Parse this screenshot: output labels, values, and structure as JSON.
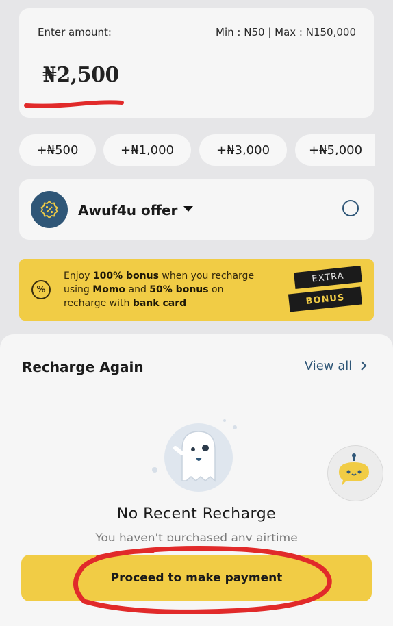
{
  "amount_card": {
    "label": "Enter amount:",
    "limits": "Min : N50 | Max : N150,000",
    "amount": "₦2,500"
  },
  "quick_amounts": [
    "+₦500",
    "+₦1,000",
    "+₦3,000",
    "+₦5,000"
  ],
  "offer": {
    "title": "Awuf4u offer",
    "selected": false
  },
  "promo": {
    "line1_a": "Enjoy ",
    "line1_b": "100% bonus",
    "line1_c": " when you recharge",
    "line2_a": "using ",
    "line2_b": "Momo",
    "line2_c": " and ",
    "line2_d": "50% bonus",
    "line2_e": " on",
    "line3_a": "recharge with ",
    "line3_b": "bank card",
    "tag_top": "EXTRA",
    "tag_bottom": "BONUS",
    "icon_glyph": "%"
  },
  "recharge_again": {
    "title": "Recharge Again",
    "view_all": "View all",
    "empty_title": "No Recent Recharge",
    "empty_sub": "You haven't purchased any airtime"
  },
  "proceed_button": "Proceed to make payment",
  "colors": {
    "accent_yellow": "#f1cc45",
    "brand_blue": "#2f5677",
    "annotation_red": "#e12a2a"
  },
  "icons": {
    "offer_badge": "discount-badge-icon",
    "dropdown": "caret-down-icon",
    "view_all_chevron": "chevron-right-icon",
    "chat_fab": "chatbot-icon",
    "empty_state": "ghost-illustration"
  }
}
